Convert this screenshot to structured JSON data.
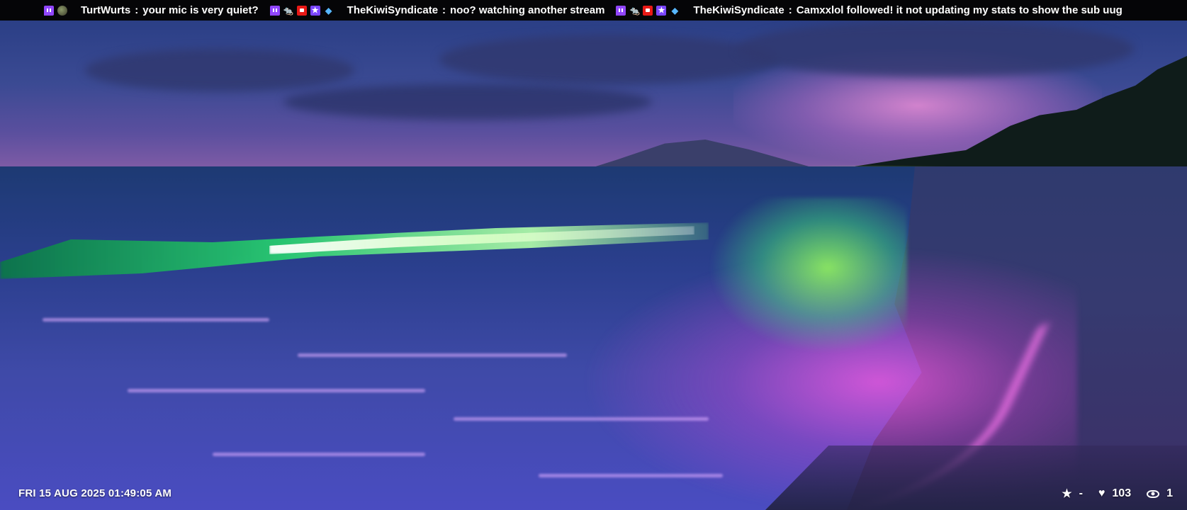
{
  "chat": {
    "messages": [
      {
        "badges": [
          "twitch-badge-icon",
          "globe-badge-icon"
        ],
        "user": "TurtWurts",
        "separator": ":",
        "text": "your mic is very quiet?"
      },
      {
        "badges": [
          "twitch-badge-icon",
          "rat-badge-icon",
          "video-badge-icon",
          "star-badge-icon",
          "gem-badge-icon"
        ],
        "user": "TheKiwiSyndicate",
        "separator": ":",
        "text": "noo?  watching another stream"
      },
      {
        "badges": [
          "twitch-badge-icon",
          "rat-badge-icon",
          "video-badge-icon",
          "star-badge-icon",
          "gem-badge-icon"
        ],
        "user": "TheKiwiSyndicate",
        "separator": ":",
        "text": "Camxxlol followed!  it not updating my stats to show the sub uug"
      }
    ]
  },
  "overlay": {
    "datetime": "FRI 15 AUG 2025 01:49:05 AM",
    "stats": {
      "star_icon": "star-icon",
      "star_value": "-",
      "heart_icon": "heart-icon",
      "heart_value": "103",
      "viewers_icon": "eye-icon",
      "viewers_value": "1"
    }
  },
  "colors": {
    "ticker_bg": "#050507",
    "twitch_purple": "#9146ff",
    "text": "#ffffff"
  }
}
